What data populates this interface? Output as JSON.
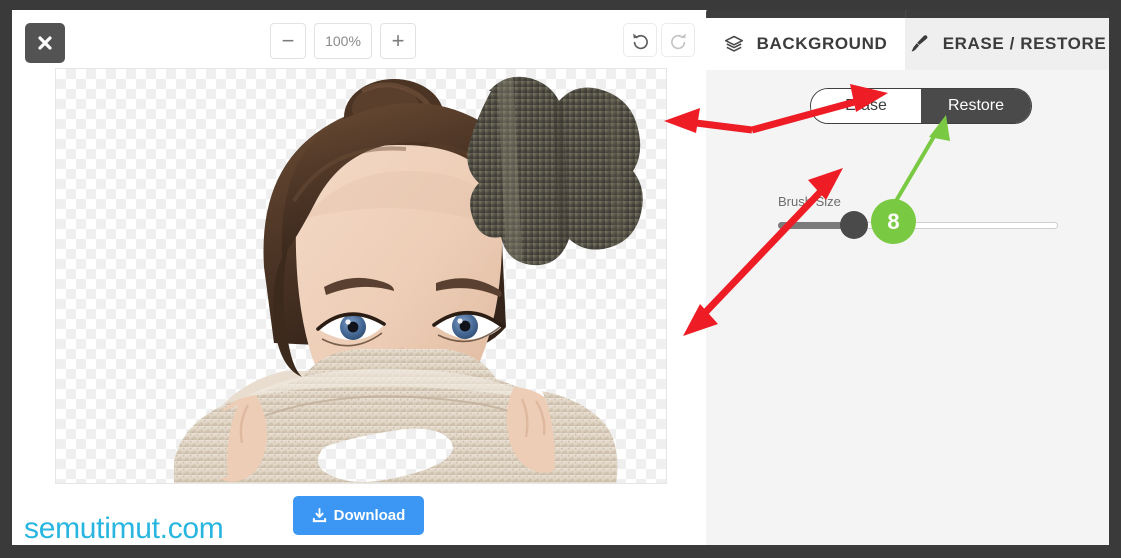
{
  "app": {
    "close_label": "✖",
    "watermark": "semutimut.com"
  },
  "toolbar": {
    "zoom_out_label": "−",
    "zoom_level": "100%",
    "zoom_in_label": "+",
    "undo_name": "undo-icon",
    "redo_name": "redo-icon"
  },
  "tabs": [
    {
      "label": "BACKGROUND",
      "icon": "layers-icon",
      "active": false
    },
    {
      "label": "ERASE / RESTORE",
      "icon": "brush-icon",
      "active": true
    }
  ],
  "panel": {
    "modes": [
      {
        "label": "Erase",
        "active": false
      },
      {
        "label": "Restore",
        "active": true
      }
    ],
    "brush_size_label": "Brush Size",
    "brush_size_value": 27
  },
  "download": {
    "label": "Download",
    "icon": "download-icon"
  },
  "annotations": {
    "badge_number": "8",
    "badge_color": "#7ac943",
    "arrow_color": "#ee1c25"
  },
  "colors": {
    "frame": "#3a3a3a",
    "panel_bg": "#f4f4f4",
    "accent_blue": "#3b97f3",
    "watermark": "#28b6e0",
    "active_mode_bg": "#4a4a4a"
  },
  "canvas": {
    "subject_description": "woman-with-turtleneck-photo",
    "brush_cursor": "brush-cursor-circle"
  }
}
